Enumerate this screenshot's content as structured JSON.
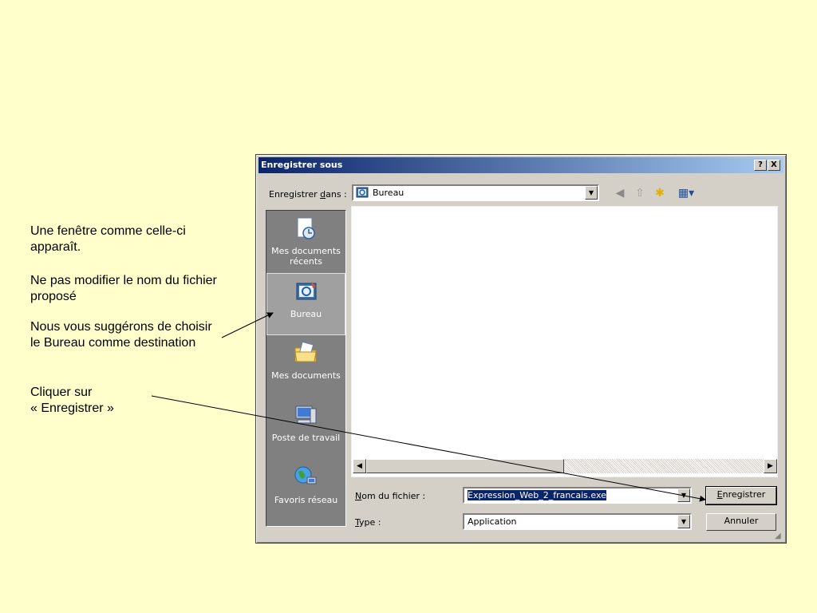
{
  "notes": {
    "p1": "Une fenêtre comme celle-ci apparaît.",
    "p2": "Ne pas modifier le nom du fichier proposé",
    "p3": "Nous vous suggérons de choisir le Bureau comme destination",
    "p4a": "Cliquer sur",
    "p4b": "« Enregistrer »"
  },
  "dialog": {
    "title": "Enregistrer sous",
    "help_btn": "?",
    "close_btn": "X",
    "lookin": {
      "label_pre": "Enregistrer ",
      "label_key": "d",
      "label_post": "ans :",
      "value": "Bureau"
    },
    "toolbar": [
      "back-icon",
      "up-folder-icon",
      "new-folder-icon",
      "view-menu-icon"
    ],
    "places": [
      {
        "label": "Mes documents récents",
        "icon": "recent-documents-icon"
      },
      {
        "label": "Bureau",
        "icon": "desktop-icon"
      },
      {
        "label": "Mes documents",
        "icon": "my-documents-icon"
      },
      {
        "label": "Poste de travail",
        "icon": "my-computer-icon"
      },
      {
        "label": "Favoris réseau",
        "icon": "network-places-icon"
      }
    ],
    "filename": {
      "label_key": "N",
      "label_rest": "om du fichier :",
      "value": "Expression_Web_2_francais.exe"
    },
    "filetype": {
      "label_key": "T",
      "label_rest": "ype :",
      "value": "Application"
    },
    "save_key": "E",
    "save_rest": "nregistrer",
    "cancel_label": "Annuler"
  },
  "colors": {
    "background": "#ffffcc",
    "titlebar_start": "#0a246a",
    "titlebar_end": "#a6caf0",
    "dialog_face": "#d4d0c8",
    "places_bg": "#808080"
  }
}
